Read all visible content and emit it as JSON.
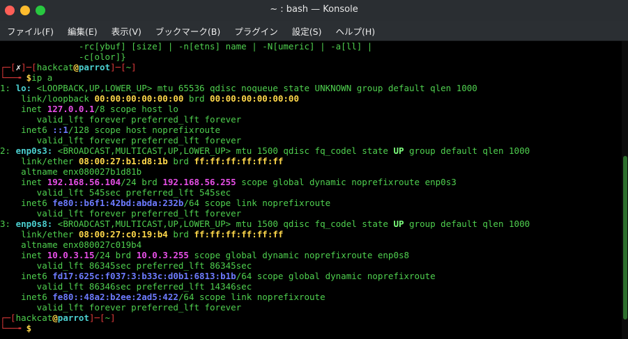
{
  "window": {
    "title": "~ : bash — Konsole"
  },
  "menu": {
    "items": [
      "ファイル(F)",
      "編集(E)",
      "表示(V)",
      "ブックマーク(B)",
      "プラグイン",
      "設定(S)",
      "ヘルプ(H)"
    ]
  },
  "terminal": {
    "lines": [
      [
        {
          "t": "               -rc[ybuf] [size] | -n[etns] name | -N[umeric] | -a[ll] |",
          "c": "g"
        }
      ],
      [
        {
          "t": "               -c[olor]}",
          "c": "g"
        }
      ],
      [
        {
          "t": "┌─[",
          "c": "r"
        },
        {
          "t": "✗",
          "c": "wb"
        },
        {
          "t": "]─[",
          "c": "r"
        },
        {
          "t": "hackcat",
          "c": "g"
        },
        {
          "t": "@",
          "c": "y"
        },
        {
          "t": "parrot",
          "c": "cb"
        },
        {
          "t": "]─[",
          "c": "r"
        },
        {
          "t": "~",
          "c": "g"
        },
        {
          "t": "]",
          "c": "r"
        }
      ],
      [
        {
          "t": "└──╼ ",
          "c": "r"
        },
        {
          "t": "$",
          "c": "y"
        },
        {
          "t": "ip a",
          "c": "g"
        }
      ],
      [
        {
          "t": "1: ",
          "c": "g"
        },
        {
          "t": "lo:",
          "c": "cb"
        },
        {
          "t": " <LOOPBACK,UP,LOWER_UP> mtu 65536 qdisc noqueue state UNKNOWN group default qlen 1000",
          "c": "g"
        }
      ],
      [
        {
          "t": "    link/loopback ",
          "c": "g"
        },
        {
          "t": "00:00:00:00:00:00",
          "c": "y"
        },
        {
          "t": " brd ",
          "c": "g"
        },
        {
          "t": "00:00:00:00:00:00",
          "c": "y"
        }
      ],
      [
        {
          "t": "    inet ",
          "c": "g"
        },
        {
          "t": "127.0.0.1",
          "c": "m"
        },
        {
          "t": "/8 scope host lo",
          "c": "g"
        }
      ],
      [
        {
          "t": "       valid_lft forever preferred_lft forever",
          "c": "g"
        }
      ],
      [
        {
          "t": "    inet6 ",
          "c": "g"
        },
        {
          "t": "::1",
          "c": "b"
        },
        {
          "t": "/128 scope host noprefixroute",
          "c": "g"
        }
      ],
      [
        {
          "t": "       valid_lft forever preferred_lft forever",
          "c": "g"
        }
      ],
      [
        {
          "t": "2: ",
          "c": "g"
        },
        {
          "t": "enp0s3:",
          "c": "cb"
        },
        {
          "t": " <BROADCAST,MULTICAST,UP,LOWER_UP> mtu 1500 qdisc fq_codel state ",
          "c": "g"
        },
        {
          "t": "UP",
          "c": "gb"
        },
        {
          "t": " group default qlen 1000",
          "c": "g"
        }
      ],
      [
        {
          "t": "    link/ether ",
          "c": "g"
        },
        {
          "t": "08:00:27:b1:d8:1b",
          "c": "y"
        },
        {
          "t": " brd ",
          "c": "g"
        },
        {
          "t": "ff:ff:ff:ff:ff:ff",
          "c": "y"
        }
      ],
      [
        {
          "t": "    altname enx080027b1d81b",
          "c": "g"
        }
      ],
      [
        {
          "t": "    inet ",
          "c": "g"
        },
        {
          "t": "192.168.56.104",
          "c": "m"
        },
        {
          "t": "/24 brd ",
          "c": "g"
        },
        {
          "t": "192.168.56.255",
          "c": "m"
        },
        {
          "t": " scope global dynamic noprefixroute enp0s3",
          "c": "g"
        }
      ],
      [
        {
          "t": "       valid_lft 545sec preferred_lft 545sec",
          "c": "g"
        }
      ],
      [
        {
          "t": "    inet6 ",
          "c": "g"
        },
        {
          "t": "fe80::b6f1:42bd:abda:232b",
          "c": "b"
        },
        {
          "t": "/64 scope link noprefixroute",
          "c": "g"
        }
      ],
      [
        {
          "t": "       valid_lft forever preferred_lft forever",
          "c": "g"
        }
      ],
      [
        {
          "t": "3: ",
          "c": "g"
        },
        {
          "t": "enp0s8:",
          "c": "cb"
        },
        {
          "t": " <BROADCAST,MULTICAST,UP,LOWER_UP> mtu 1500 qdisc fq_codel state ",
          "c": "g"
        },
        {
          "t": "UP",
          "c": "gb"
        },
        {
          "t": " group default qlen 1000",
          "c": "g"
        }
      ],
      [
        {
          "t": "    link/ether ",
          "c": "g"
        },
        {
          "t": "08:00:27:c0:19:b4",
          "c": "y"
        },
        {
          "t": " brd ",
          "c": "g"
        },
        {
          "t": "ff:ff:ff:ff:ff:ff",
          "c": "y"
        }
      ],
      [
        {
          "t": "    altname enx080027c019b4",
          "c": "g"
        }
      ],
      [
        {
          "t": "    inet ",
          "c": "g"
        },
        {
          "t": "10.0.3.15",
          "c": "m"
        },
        {
          "t": "/24 brd ",
          "c": "g"
        },
        {
          "t": "10.0.3.255",
          "c": "m"
        },
        {
          "t": " scope global dynamic noprefixroute enp0s8",
          "c": "g"
        }
      ],
      [
        {
          "t": "       valid_lft 86345sec preferred_lft 86345sec",
          "c": "g"
        }
      ],
      [
        {
          "t": "    inet6 ",
          "c": "g"
        },
        {
          "t": "fd17:625c:f037:3:b33c:d0b1:6813:b1b",
          "c": "b"
        },
        {
          "t": "/64 scope global dynamic noprefixroute",
          "c": "g"
        }
      ],
      [
        {
          "t": "       valid_lft 86346sec preferred_lft 14346sec",
          "c": "g"
        }
      ],
      [
        {
          "t": "    inet6 ",
          "c": "g"
        },
        {
          "t": "fe80::48a2:b2ee:2ad5:422",
          "c": "b"
        },
        {
          "t": "/64 scope link noprefixroute",
          "c": "g"
        }
      ],
      [
        {
          "t": "       valid_lft forever preferred_lft forever",
          "c": "g"
        }
      ],
      [
        {
          "t": "┌─[",
          "c": "r"
        },
        {
          "t": "hackcat",
          "c": "g"
        },
        {
          "t": "@",
          "c": "y"
        },
        {
          "t": "parrot",
          "c": "cb"
        },
        {
          "t": "]─[",
          "c": "r"
        },
        {
          "t": "~",
          "c": "g"
        },
        {
          "t": "]",
          "c": "r"
        }
      ],
      [
        {
          "t": "└──╼ ",
          "c": "r"
        },
        {
          "t": "$",
          "c": "y"
        }
      ]
    ]
  },
  "colors": {
    "titlebar": "#2a2e32",
    "terminal_bg": "#000000",
    "text_green": "#4fd04f",
    "prompt_red": "#e03b3b",
    "addr_magenta": "#e74fe7",
    "addr_blue": "#6d7bff",
    "mac_yellow": "#ffd84a"
  }
}
